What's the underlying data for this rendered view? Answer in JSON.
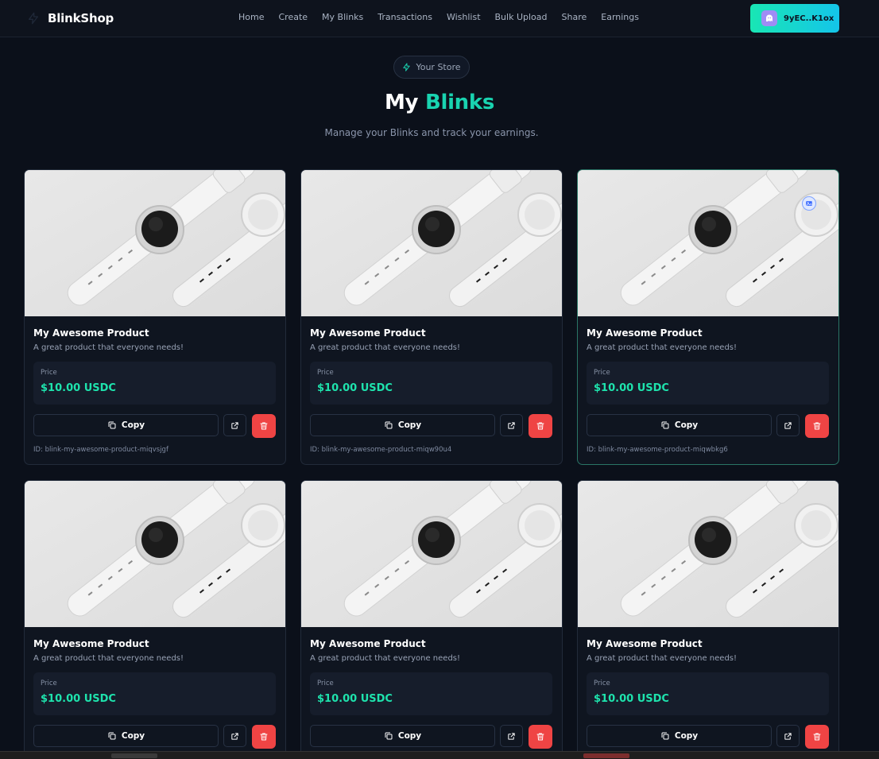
{
  "header": {
    "brand": "BlinkShop",
    "nav": [
      "Home",
      "Create",
      "My Blinks",
      "Transactions",
      "Wishlist",
      "Bulk Upload",
      "Share",
      "Earnings"
    ],
    "wallet": "9yEC..K1ox"
  },
  "hero": {
    "badge": "Your Store",
    "title_main": "My",
    "title_accent": "Blinks",
    "subtitle": "Manage your Blinks and track your earnings."
  },
  "cards": [
    {
      "title": "My Awesome Product",
      "description": "A great product that everyone needs!",
      "price_label": "Price",
      "price": "$10.00 USDC",
      "copy_label": "Copy",
      "id": "ID: blink-my-awesome-product-miqvsjgf"
    },
    {
      "title": "My Awesome Product",
      "description": "A great product that everyone needs!",
      "price_label": "Price",
      "price": "$10.00 USDC",
      "copy_label": "Copy",
      "id": "ID: blink-my-awesome-product-miqw90u4"
    },
    {
      "title": "My Awesome Product",
      "description": "A great product that everyone needs!",
      "price_label": "Price",
      "price": "$10.00 USDC",
      "copy_label": "Copy",
      "id": "ID: blink-my-awesome-product-miqwbkg6"
    },
    {
      "title": "My Awesome Product",
      "description": "A great product that everyone needs!",
      "price_label": "Price",
      "price": "$10.00 USDC",
      "copy_label": "Copy",
      "id": ""
    },
    {
      "title": "My Awesome Product",
      "description": "A great product that everyone needs!",
      "price_label": "Price",
      "price": "$10.00 USDC",
      "copy_label": "Copy",
      "id": ""
    },
    {
      "title": "My Awesome Product",
      "description": "A great product that everyone needs!",
      "price_label": "Price",
      "price": "$10.00 USDC",
      "copy_label": "Copy",
      "id": ""
    }
  ],
  "colors": {
    "accent": "#19d3b0",
    "price": "#1ee3ad",
    "delete": "#ef4444",
    "background": "#0b101a"
  },
  "icons": {
    "brand": "bolt-icon",
    "badge": "bolt-icon",
    "wallet": "ghost-icon",
    "copy": "copy-icon",
    "external": "external-link-icon",
    "delete": "trash-icon"
  }
}
